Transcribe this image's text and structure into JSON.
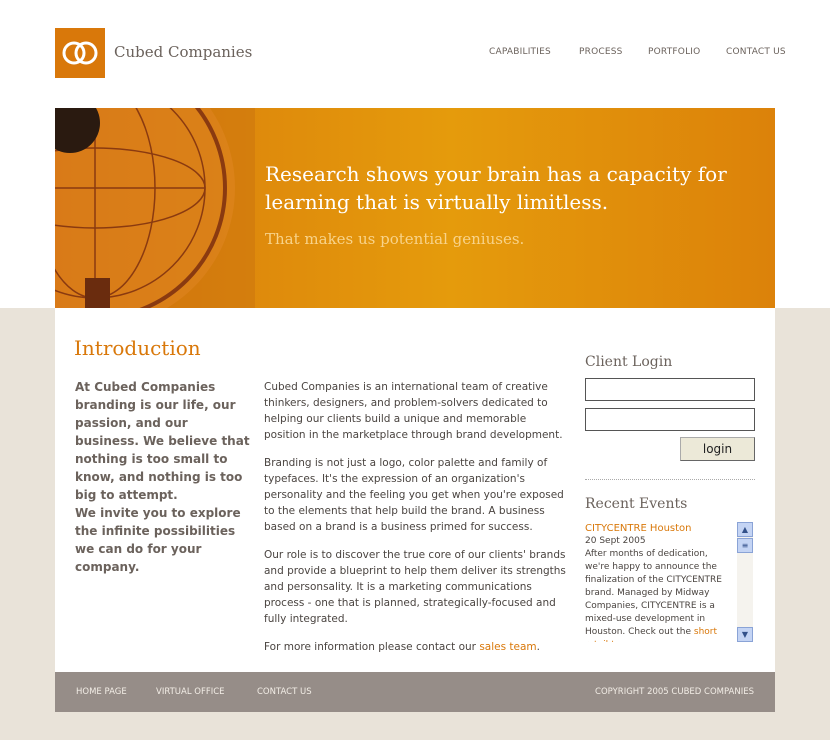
{
  "header": {
    "brand": "Cubed Companies",
    "nav": [
      "CAPABILITIES",
      "PROCESS",
      "PORTFOLIO",
      "CONTACT US"
    ]
  },
  "hero": {
    "headline": "Research shows your brain has a capacity for learning that is virtually limitless.",
    "subhead": "That makes us potential geniuses."
  },
  "intro": {
    "title": "Introduction",
    "lead1": "At Cubed Companies branding is our life, our passion, and our business. We believe that nothing is too small to know, and nothing is too big to attempt.",
    "lead2": "We invite you to explore the infinite possibilities we can do for your company.",
    "p1": "Cubed Companies is an international team of creative thinkers, designers, and problem-solvers dedicated to helping our clients build a unique and memorable position in the marketplace through brand development.",
    "p2": "Branding is not just a logo, color palette and family of typefaces. It's the expression of an organization's personality and the feeling you get when you're exposed to the elements that help build the brand. A business based on a brand is a business primed for success.",
    "p3": "Our role is to discover the true core of our clients' brands and provide a blueprint to help them deliver its strengths and personsality. It is a marketing communications process - one that is planned, strategically-focused and fully integrated.",
    "p4_prefix": "For more information please contact our ",
    "p4_link": "sales team",
    "p4_suffix": "."
  },
  "login": {
    "title": "Client Login",
    "username": "",
    "password": "",
    "button": "login"
  },
  "events": {
    "title": "Recent Events",
    "item_title": "CITYCENTRE Houston",
    "date": "20 Sept 2005",
    "text": "After months of dedication, we're happy to announce the finalization of the CITYCENTRE brand. Managed by Midway Companies, CITYCENTRE is a mixed-use development in Houston. Check out the ",
    "link": "short retail-teaser we"
  },
  "footer": {
    "links": [
      "HOME PAGE",
      "VIRTUAL OFFICE",
      "CONTACT US"
    ],
    "copyright": "COPYRIGHT 2005 CUBED COMPANIES"
  },
  "colors": {
    "accent": "#d9780a",
    "footer": "#968d88",
    "background": "#e9e3d9"
  }
}
